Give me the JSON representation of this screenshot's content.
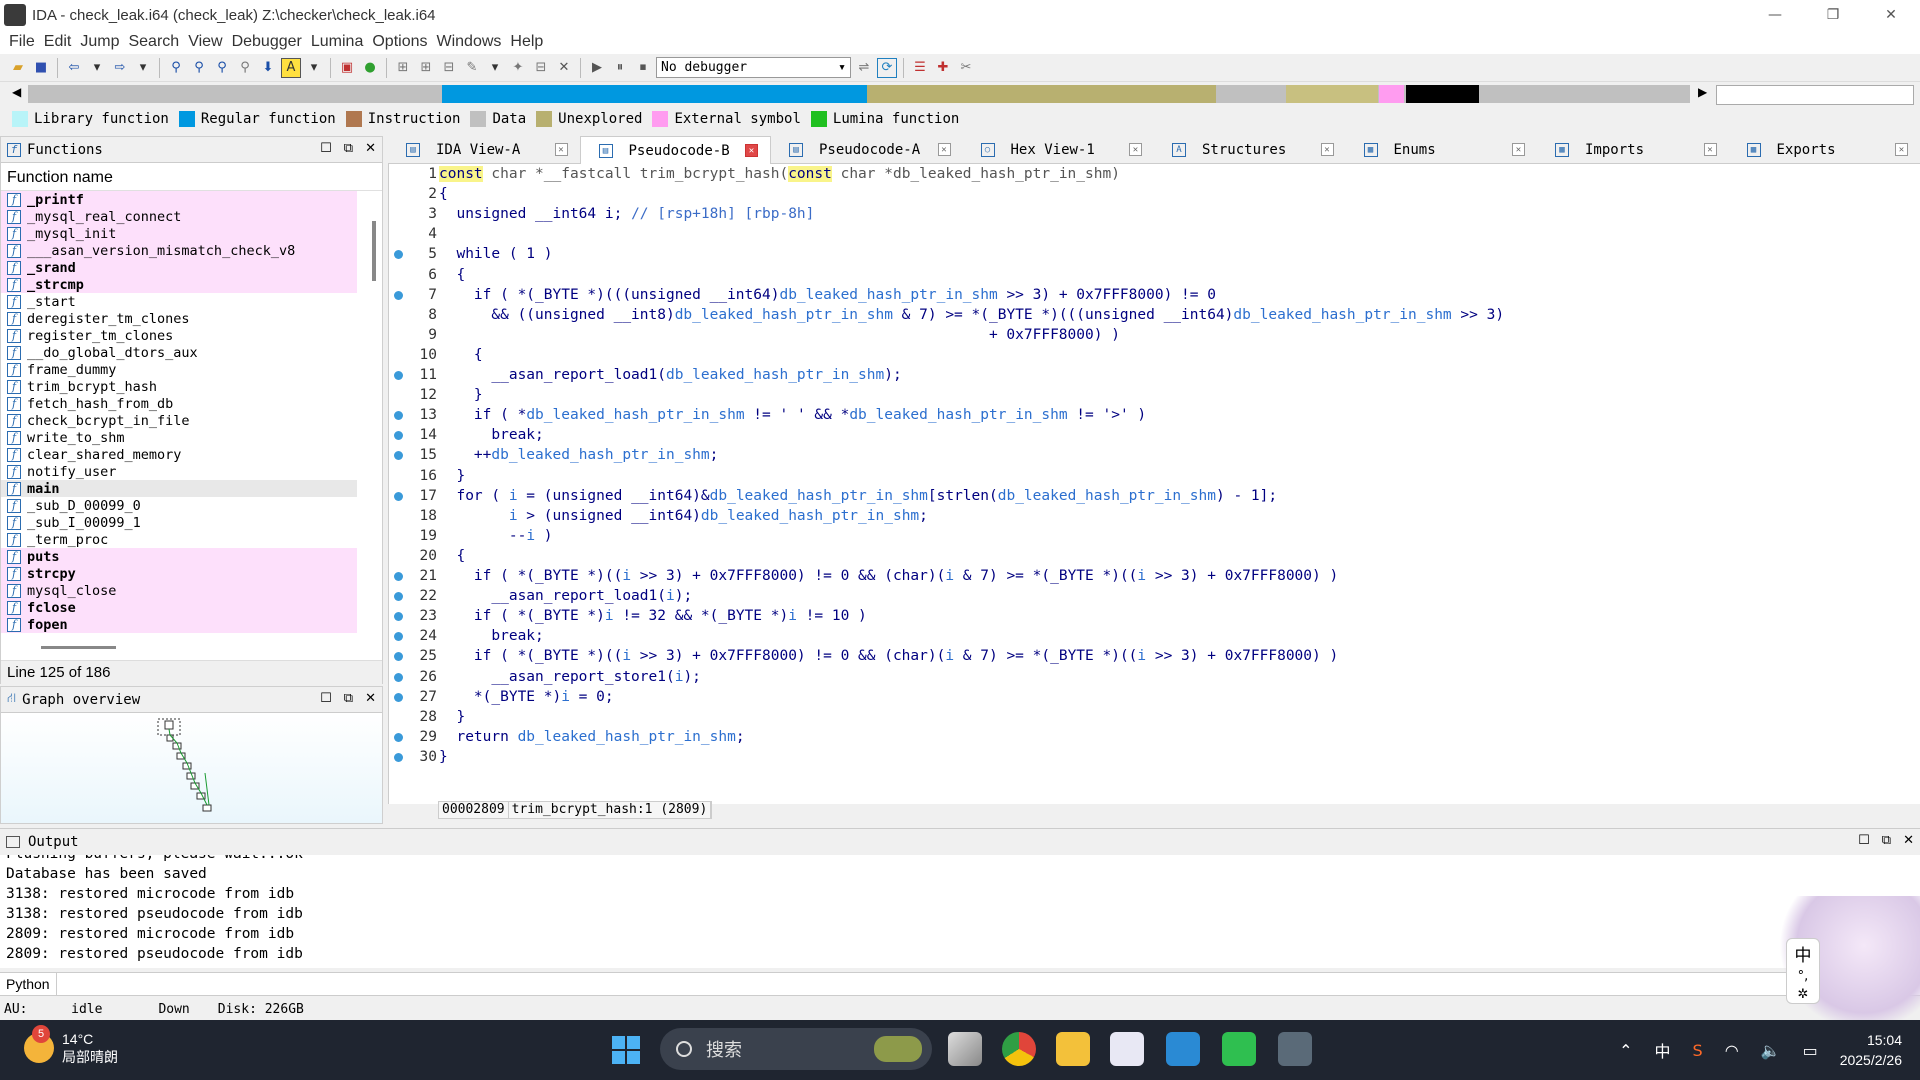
{
  "window": {
    "title": "IDA - check_leak.i64 (check_leak) Z:\\checker\\check_leak.i64",
    "controls": [
      "—",
      "❐",
      "✕"
    ]
  },
  "menu": [
    "File",
    "Edit",
    "Jump",
    "Search",
    "View",
    "Debugger",
    "Lumina",
    "Options",
    "Windows",
    "Help"
  ],
  "toolbar": {
    "debugger_select": "No debugger"
  },
  "navband": {
    "segments": [
      {
        "kind": "unexplored",
        "from": 0.0,
        "to": 0.248,
        "color": "#c0c0c0"
      },
      {
        "kind": "regular",
        "from": 0.249,
        "to": 0.505,
        "color": "#0098e0"
      },
      {
        "kind": "data",
        "from": 0.505,
        "to": 0.715,
        "color": "#b8b070"
      },
      {
        "kind": "unexplored",
        "from": 0.715,
        "to": 0.757,
        "color": "#c0c0c0"
      },
      {
        "kind": "data",
        "from": 0.757,
        "to": 0.812,
        "color": "#c8c080"
      },
      {
        "kind": "external",
        "from": 0.813,
        "to": 0.828,
        "color": "#ff9cf0"
      },
      {
        "kind": "black",
        "from": 0.829,
        "to": 0.873,
        "color": "#000000"
      }
    ]
  },
  "legend": [
    {
      "label": "Library function",
      "color": "#b8f4f8"
    },
    {
      "label": "Regular function",
      "color": "#0098e0"
    },
    {
      "label": "Instruction",
      "color": "#b07850"
    },
    {
      "label": "Data",
      "color": "#c0c0c0"
    },
    {
      "label": "Unexplored",
      "color": "#b8b070"
    },
    {
      "label": "External symbol",
      "color": "#ff9cf0"
    },
    {
      "label": "Lumina function",
      "color": "#20c020"
    }
  ],
  "functions": {
    "title": "Functions",
    "column": "Function name",
    "status": "Line 125 of 186",
    "items": [
      {
        "name": "_printf",
        "lib": true,
        "bold": true
      },
      {
        "name": "_mysql_real_connect",
        "lib": true,
        "bold": false
      },
      {
        "name": "_mysql_init",
        "lib": true,
        "bold": false
      },
      {
        "name": "___asan_version_mismatch_check_v8",
        "lib": true,
        "bold": false
      },
      {
        "name": "_srand",
        "lib": true,
        "bold": true
      },
      {
        "name": "_strcmp",
        "lib": true,
        "bold": true
      },
      {
        "name": "_start",
        "lib": false,
        "bold": false
      },
      {
        "name": "deregister_tm_clones",
        "lib": false,
        "bold": false
      },
      {
        "name": "register_tm_clones",
        "lib": false,
        "bold": false
      },
      {
        "name": "__do_global_dtors_aux",
        "lib": false,
        "bold": false
      },
      {
        "name": "frame_dummy",
        "lib": false,
        "bold": false
      },
      {
        "name": "trim_bcrypt_hash",
        "lib": false,
        "bold": false
      },
      {
        "name": "fetch_hash_from_db",
        "lib": false,
        "bold": false
      },
      {
        "name": "check_bcrypt_in_file",
        "lib": false,
        "bold": false
      },
      {
        "name": "write_to_shm",
        "lib": false,
        "bold": false
      },
      {
        "name": "clear_shared_memory",
        "lib": false,
        "bold": false
      },
      {
        "name": "notify_user",
        "lib": false,
        "bold": false
      },
      {
        "name": "main",
        "lib": false,
        "bold": true,
        "selected": true
      },
      {
        "name": "_sub_D_00099_0",
        "lib": false,
        "bold": false
      },
      {
        "name": "_sub_I_00099_1",
        "lib": false,
        "bold": false
      },
      {
        "name": "_term_proc",
        "lib": false,
        "bold": false
      },
      {
        "name": "puts",
        "lib": true,
        "bold": true
      },
      {
        "name": "strcpy",
        "lib": true,
        "bold": true
      },
      {
        "name": "mysql_close",
        "lib": true,
        "bold": false
      },
      {
        "name": "fclose",
        "lib": true,
        "bold": true
      },
      {
        "name": "fopen",
        "lib": true,
        "bold": true
      }
    ]
  },
  "graph_overview": {
    "title": "Graph overview"
  },
  "tabs": [
    {
      "label": "IDA View-A",
      "active": false
    },
    {
      "label": "Pseudocode-B",
      "active": true
    },
    {
      "label": "Pseudocode-A",
      "active": false
    },
    {
      "label": "Hex View-1",
      "active": false
    },
    {
      "label": "Structures",
      "active": false
    },
    {
      "label": "Enums",
      "active": false
    },
    {
      "label": "Imports",
      "active": false
    },
    {
      "label": "Exports",
      "active": false
    }
  ],
  "code": [
    {
      "n": "1",
      "dot": false,
      "html": "<span class=\"kw\">const</span> <span class=\"gr\">char *__fastcall trim_bcrypt_hash(</span><span class=\"kw\">const</span><span class=\"gr\"> char *db_leaked_hash_ptr_in_shm)</span>"
    },
    {
      "n": "2",
      "dot": false,
      "html": "{"
    },
    {
      "n": "3",
      "dot": false,
      "html": "  unsigned __int64 i; <span class=\"cm\">// [rsp+18h] [rbp-8h]</span>"
    },
    {
      "n": "4",
      "dot": false,
      "html": ""
    },
    {
      "n": "5",
      "dot": true,
      "html": "  while ( 1 )"
    },
    {
      "n": "6",
      "dot": false,
      "html": "  {"
    },
    {
      "n": "7",
      "dot": true,
      "html": "    if ( *(_BYTE *)(((unsigned __int64)<span class=\"var\">db_leaked_hash_ptr_in_shm</span> >> 3) + 0x7FFF8000) != 0"
    },
    {
      "n": "8",
      "dot": false,
      "html": "      && ((unsigned __int8)<span class=\"var\">db_leaked_hash_ptr_in_shm</span> & 7) >= *(_BYTE *)(((unsigned __int64)<span class=\"var\">db_leaked_hash_ptr_in_shm</span> >> 3)"
    },
    {
      "n": "9",
      "dot": false,
      "html": "                                                               + 0x7FFF8000) )"
    },
    {
      "n": "10",
      "dot": false,
      "html": "    {"
    },
    {
      "n": "11",
      "dot": true,
      "html": "      __asan_report_load1(<span class=\"var\">db_leaked_hash_ptr_in_shm</span>);"
    },
    {
      "n": "12",
      "dot": false,
      "html": "    }"
    },
    {
      "n": "13",
      "dot": true,
      "html": "    if ( *<span class=\"var\">db_leaked_hash_ptr_in_shm</span> != ' ' && *<span class=\"var\">db_leaked_hash_ptr_in_shm</span> != '>' )"
    },
    {
      "n": "14",
      "dot": true,
      "html": "      break;"
    },
    {
      "n": "15",
      "dot": true,
      "html": "    ++<span class=\"var\">db_leaked_hash_ptr_in_shm</span>;"
    },
    {
      "n": "16",
      "dot": false,
      "html": "  }"
    },
    {
      "n": "17",
      "dot": true,
      "html": "  for ( <span class=\"var\">i</span> = (unsigned __int64)&<span class=\"var\">db_leaked_hash_ptr_in_shm</span>[strlen(<span class=\"var\">db_leaked_hash_ptr_in_shm</span>) - 1];"
    },
    {
      "n": "18",
      "dot": false,
      "html": "        <span class=\"var\">i</span> > (unsigned __int64)<span class=\"var\">db_leaked_hash_ptr_in_shm</span>;"
    },
    {
      "n": "19",
      "dot": false,
      "html": "        --<span class=\"var\">i</span> )"
    },
    {
      "n": "20",
      "dot": false,
      "html": "  {"
    },
    {
      "n": "21",
      "dot": true,
      "html": "    if ( *(_BYTE *)((<span class=\"var\">i</span> >> 3) + 0x7FFF8000) != 0 && (char)(<span class=\"var\">i</span> & 7) >= *(_BYTE *)((<span class=\"var\">i</span> >> 3) + 0x7FFF8000) )"
    },
    {
      "n": "22",
      "dot": true,
      "html": "      __asan_report_load1(<span class=\"var\">i</span>);"
    },
    {
      "n": "23",
      "dot": true,
      "html": "    if ( *(_BYTE *)<span class=\"var\">i</span> != 32 && *(_BYTE *)<span class=\"var\">i</span> != 10 )"
    },
    {
      "n": "24",
      "dot": true,
      "html": "      break;"
    },
    {
      "n": "25",
      "dot": true,
      "html": "    if ( *(_BYTE *)((<span class=\"var\">i</span> >> 3) + 0x7FFF8000) != 0 && (char)(<span class=\"var\">i</span> & 7) >= *(_BYTE *)((<span class=\"var\">i</span> >> 3) + 0x7FFF8000) )"
    },
    {
      "n": "26",
      "dot": true,
      "html": "      __asan_report_store1(<span class=\"var\">i</span>);"
    },
    {
      "n": "27",
      "dot": true,
      "html": "    *(_BYTE *)<span class=\"var\">i</span> = 0;"
    },
    {
      "n": "28",
      "dot": false,
      "html": "  }"
    },
    {
      "n": "29",
      "dot": true,
      "html": "  return <span class=\"var\">db_leaked_hash_ptr_in_shm</span>;"
    },
    {
      "n": "30",
      "dot": true,
      "html": "}"
    }
  ],
  "code_status": {
    "address": "00002809",
    "location": "trim_bcrypt_hash:1 (2809)"
  },
  "output": {
    "title": "Output",
    "lines": [
      "Flushing buffers, please wait...ok",
      "Database has been saved",
      "3138: restored microcode from idb",
      "3138: restored pseudocode from idb",
      "2809: restored microcode from idb",
      "2809: restored pseudocode from idb"
    ]
  },
  "python_label": "Python",
  "status": {
    "au": "AU:",
    "state": "idle",
    "dir": "Down",
    "disk": "Disk: 226GB"
  },
  "taskbar": {
    "weather_temp": "14°C",
    "weather_desc": "局部晴朗",
    "weather_badge": "5",
    "search_placeholder": "搜索",
    "ime": "中",
    "time": "15:04",
    "date": "2025/2/26"
  }
}
